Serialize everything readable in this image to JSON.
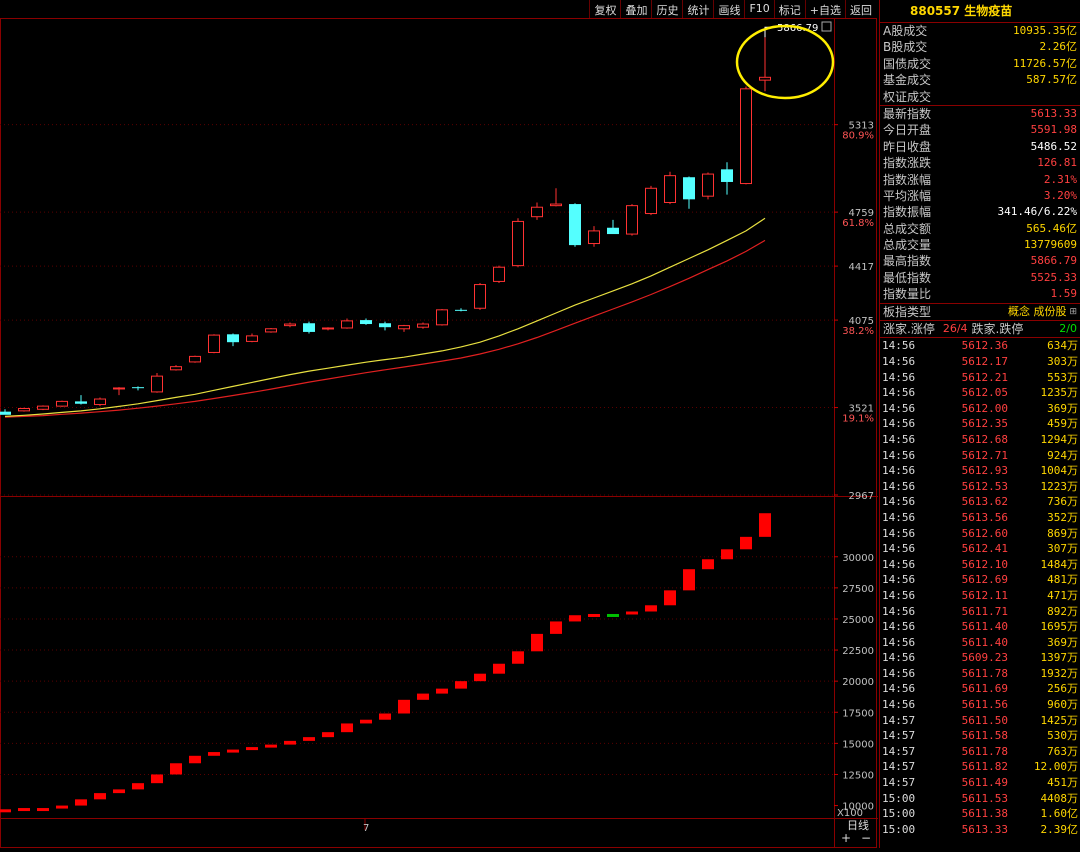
{
  "toolbar": {
    "buttons": [
      "复权",
      "叠加",
      "历史",
      "统计",
      "画线",
      "F10",
      "标记",
      "+自选",
      "返回"
    ]
  },
  "chart": {
    "price_labels": [
      "5313",
      "4759",
      "4417",
      "4075",
      "3521",
      "2967"
    ],
    "pct_labels": [
      "80.9%",
      "61.8%",
      "38.2%",
      "19.1%"
    ],
    "volume_labels": [
      "30000",
      "27500",
      "25000",
      "22500",
      "20000",
      "17500",
      "15000",
      "12500",
      "10000"
    ],
    "volume_unit": "X100",
    "peak_label": "5866.79",
    "x_marker": "7",
    "period": "日线"
  },
  "chart_data": {
    "type": "candlestick",
    "title": "880557 生物疫苗",
    "ylim": [
      2967,
      5900
    ],
    "volume_ylim": [
      9000,
      34000
    ],
    "candles": [
      {
        "o": 3495,
        "h": 3510,
        "l": 3480,
        "c": 3475,
        "up": false
      },
      {
        "o": 3500,
        "h": 3520,
        "l": 3495,
        "c": 3515,
        "up": true
      },
      {
        "o": 3510,
        "h": 3535,
        "l": 3505,
        "c": 3530,
        "up": true
      },
      {
        "o": 3530,
        "h": 3565,
        "l": 3525,
        "c": 3560,
        "up": true
      },
      {
        "o": 3560,
        "h": 3600,
        "l": 3540,
        "c": 3545,
        "up": false
      },
      {
        "o": 3540,
        "h": 3585,
        "l": 3530,
        "c": 3575,
        "up": true
      },
      {
        "o": 3640,
        "h": 3650,
        "l": 3600,
        "c": 3645,
        "up": true
      },
      {
        "o": 3650,
        "h": 3655,
        "l": 3630,
        "c": 3645,
        "up": false
      },
      {
        "o": 3620,
        "h": 3740,
        "l": 3615,
        "c": 3720,
        "up": true
      },
      {
        "o": 3760,
        "h": 3790,
        "l": 3755,
        "c": 3780,
        "up": true
      },
      {
        "o": 3810,
        "h": 3850,
        "l": 3805,
        "c": 3845,
        "up": true
      },
      {
        "o": 3870,
        "h": 3985,
        "l": 3865,
        "c": 3980,
        "up": true
      },
      {
        "o": 3985,
        "h": 3990,
        "l": 3910,
        "c": 3935,
        "up": false
      },
      {
        "o": 3940,
        "h": 3990,
        "l": 3935,
        "c": 3975,
        "up": true
      },
      {
        "o": 4000,
        "h": 4025,
        "l": 3995,
        "c": 4020,
        "up": true
      },
      {
        "o": 4040,
        "h": 4060,
        "l": 4030,
        "c": 4050,
        "up": true
      },
      {
        "o": 4055,
        "h": 4065,
        "l": 3990,
        "c": 4000,
        "up": false
      },
      {
        "o": 4020,
        "h": 4030,
        "l": 4010,
        "c": 4025,
        "up": true
      },
      {
        "o": 4025,
        "h": 4085,
        "l": 4020,
        "c": 4070,
        "up": true
      },
      {
        "o": 4075,
        "h": 4085,
        "l": 4045,
        "c": 4050,
        "up": false
      },
      {
        "o": 4055,
        "h": 4065,
        "l": 4010,
        "c": 4030,
        "up": false
      },
      {
        "o": 4020,
        "h": 4045,
        "l": 4000,
        "c": 4040,
        "up": true
      },
      {
        "o": 4030,
        "h": 4060,
        "l": 4020,
        "c": 4050,
        "up": true
      },
      {
        "o": 4045,
        "h": 4145,
        "l": 4040,
        "c": 4140,
        "up": true
      },
      {
        "o": 4140,
        "h": 4150,
        "l": 4130,
        "c": 4140,
        "up": false
      },
      {
        "o": 4150,
        "h": 4310,
        "l": 4140,
        "c": 4300,
        "up": true
      },
      {
        "o": 4320,
        "h": 4420,
        "l": 4310,
        "c": 4410,
        "up": true
      },
      {
        "o": 4420,
        "h": 4720,
        "l": 4410,
        "c": 4700,
        "up": true
      },
      {
        "o": 4730,
        "h": 4820,
        "l": 4710,
        "c": 4790,
        "up": true
      },
      {
        "o": 4800,
        "h": 4910,
        "l": 4795,
        "c": 4810,
        "up": true
      },
      {
        "o": 4810,
        "h": 4815,
        "l": 4540,
        "c": 4550,
        "up": false
      },
      {
        "o": 4560,
        "h": 4670,
        "l": 4540,
        "c": 4640,
        "up": true
      },
      {
        "o": 4660,
        "h": 4710,
        "l": 4630,
        "c": 4620,
        "up": false
      },
      {
        "o": 4620,
        "h": 4810,
        "l": 4610,
        "c": 4800,
        "up": true
      },
      {
        "o": 4750,
        "h": 4925,
        "l": 4740,
        "c": 4910,
        "up": true
      },
      {
        "o": 4820,
        "h": 5015,
        "l": 4810,
        "c": 4990,
        "up": true
      },
      {
        "o": 4980,
        "h": 4985,
        "l": 4780,
        "c": 4840,
        "up": false
      },
      {
        "o": 4860,
        "h": 5010,
        "l": 4840,
        "c": 5000,
        "up": true
      },
      {
        "o": 5030,
        "h": 5075,
        "l": 4870,
        "c": 4950,
        "up": false
      },
      {
        "o": 4940,
        "h": 5555,
        "l": 4935,
        "c": 5540,
        "up": true
      },
      {
        "o": 5595,
        "h": 5867,
        "l": 5525,
        "c": 5613,
        "up": true
      }
    ],
    "ma_short": [
      3465,
      3472,
      3480,
      3490,
      3500,
      3513,
      3528,
      3545,
      3565,
      3585,
      3605,
      3630,
      3655,
      3680,
      3705,
      3730,
      3752,
      3770,
      3790,
      3808,
      3825,
      3840,
      3860,
      3880,
      3905,
      3935,
      3975,
      4020,
      4070,
      4120,
      4170,
      4215,
      4260,
      4305,
      4355,
      4410,
      4465,
      4520,
      4580,
      4640,
      4720
    ],
    "ma_long": [
      3460,
      3465,
      3470,
      3478,
      3486,
      3495,
      3505,
      3517,
      3530,
      3545,
      3560,
      3578,
      3597,
      3617,
      3638,
      3660,
      3682,
      3702,
      3722,
      3742,
      3760,
      3778,
      3796,
      3815,
      3835,
      3860,
      3890,
      3925,
      3965,
      4010,
      4055,
      4100,
      4145,
      4190,
      4237,
      4287,
      4340,
      4395,
      4450,
      4510,
      4580
    ],
    "volume_x100": [
      9700,
      9800,
      9800,
      10000,
      10500,
      11000,
      11300,
      11800,
      12500,
      13400,
      14000,
      14300,
      14500,
      14700,
      14900,
      15200,
      15500,
      15900,
      16600,
      16900,
      17400,
      18500,
      19000,
      19400,
      20000,
      20600,
      21400,
      22400,
      23800,
      24800,
      25300,
      25400,
      25400,
      25600,
      26100,
      27300,
      29000,
      29800,
      30600,
      31600,
      33500
    ],
    "volume_up": [
      true,
      true,
      true,
      true,
      true,
      true,
      true,
      true,
      true,
      true,
      true,
      true,
      true,
      true,
      true,
      true,
      true,
      true,
      true,
      true,
      true,
      true,
      true,
      true,
      true,
      true,
      true,
      true,
      true,
      true,
      true,
      true,
      false,
      true,
      true,
      true,
      true,
      true,
      true,
      true,
      true
    ]
  },
  "panel": {
    "title": "880557 生物疫苗",
    "stats": [
      {
        "label": "A股成交",
        "value": "10935.35亿",
        "color": "#ffd700"
      },
      {
        "label": "B股成交",
        "value": "2.26亿",
        "color": "#ffd700"
      },
      {
        "label": "国债成交",
        "value": "11726.57亿",
        "color": "#ffd700"
      },
      {
        "label": "基金成交",
        "value": "587.57亿",
        "color": "#ffd700"
      },
      {
        "label": "权证成交",
        "value": "",
        "color": "#ffd700"
      }
    ],
    "index": [
      {
        "label": "最新指数",
        "value": "5613.33",
        "color": "#ff4040"
      },
      {
        "label": "今日开盘",
        "value": "5591.98",
        "color": "#ff4040"
      },
      {
        "label": "昨日收盘",
        "value": "5486.52",
        "color": "#ffffff"
      },
      {
        "label": "指数涨跌",
        "value": "126.81",
        "color": "#ff4040"
      },
      {
        "label": "指数涨幅",
        "value": "2.31%",
        "color": "#ff4040"
      },
      {
        "label": "平均涨幅",
        "value": "3.20%",
        "color": "#ff4040"
      },
      {
        "label": "指数振幅",
        "value": "341.46/6.22%",
        "color": "#ffffff"
      },
      {
        "label": "总成交额",
        "value": "565.46亿",
        "color": "#ffd700"
      },
      {
        "label": "总成交量",
        "value": "13779609",
        "color": "#ffd700"
      },
      {
        "label": "最高指数",
        "value": "5866.79",
        "color": "#ff4040"
      },
      {
        "label": "最低指数",
        "value": "5525.33",
        "color": "#ff4040"
      },
      {
        "label": "指数量比",
        "value": "1.59",
        "color": "#ff4040"
      }
    ],
    "type_label": "板指类型",
    "type_value": "概念 成份股",
    "rise_label": "涨家.涨停",
    "rise_value": "26/4",
    "fall_label": "跌家.跌停",
    "fall_value": "2/0",
    "ticks": [
      {
        "t": "14:56",
        "p": "5612.36",
        "v": "634万"
      },
      {
        "t": "14:56",
        "p": "5612.17",
        "v": "303万"
      },
      {
        "t": "14:56",
        "p": "5612.21",
        "v": "553万"
      },
      {
        "t": "14:56",
        "p": "5612.05",
        "v": "1235万"
      },
      {
        "t": "14:56",
        "p": "5612.00",
        "v": "369万"
      },
      {
        "t": "14:56",
        "p": "5612.35",
        "v": "459万"
      },
      {
        "t": "14:56",
        "p": "5612.68",
        "v": "1294万"
      },
      {
        "t": "14:56",
        "p": "5612.71",
        "v": "924万"
      },
      {
        "t": "14:56",
        "p": "5612.93",
        "v": "1004万"
      },
      {
        "t": "14:56",
        "p": "5612.53",
        "v": "1223万"
      },
      {
        "t": "14:56",
        "p": "5613.62",
        "v": "736万"
      },
      {
        "t": "14:56",
        "p": "5613.56",
        "v": "352万"
      },
      {
        "t": "14:56",
        "p": "5612.60",
        "v": "869万"
      },
      {
        "t": "14:56",
        "p": "5612.41",
        "v": "307万"
      },
      {
        "t": "14:56",
        "p": "5612.10",
        "v": "1484万"
      },
      {
        "t": "14:56",
        "p": "5612.69",
        "v": "481万"
      },
      {
        "t": "14:56",
        "p": "5612.11",
        "v": "471万"
      },
      {
        "t": "14:56",
        "p": "5611.71",
        "v": "892万"
      },
      {
        "t": "14:56",
        "p": "5611.40",
        "v": "1695万"
      },
      {
        "t": "14:56",
        "p": "5611.40",
        "v": "369万"
      },
      {
        "t": "14:56",
        "p": "5609.23",
        "v": "1397万"
      },
      {
        "t": "14:56",
        "p": "5611.78",
        "v": "1932万"
      },
      {
        "t": "14:56",
        "p": "5611.69",
        "v": "256万"
      },
      {
        "t": "14:56",
        "p": "5611.56",
        "v": "960万"
      },
      {
        "t": "14:57",
        "p": "5611.50",
        "v": "1425万"
      },
      {
        "t": "14:57",
        "p": "5611.58",
        "v": "530万"
      },
      {
        "t": "14:57",
        "p": "5611.78",
        "v": "763万"
      },
      {
        "t": "14:57",
        "p": "5611.82",
        "v": "12.00万"
      },
      {
        "t": "14:57",
        "p": "5611.49",
        "v": "451万"
      },
      {
        "t": "15:00",
        "p": "5611.53",
        "v": "4408万"
      },
      {
        "t": "15:00",
        "p": "5611.38",
        "v": "1.60亿"
      },
      {
        "t": "15:00",
        "p": "5613.33",
        "v": "2.39亿"
      }
    ]
  }
}
